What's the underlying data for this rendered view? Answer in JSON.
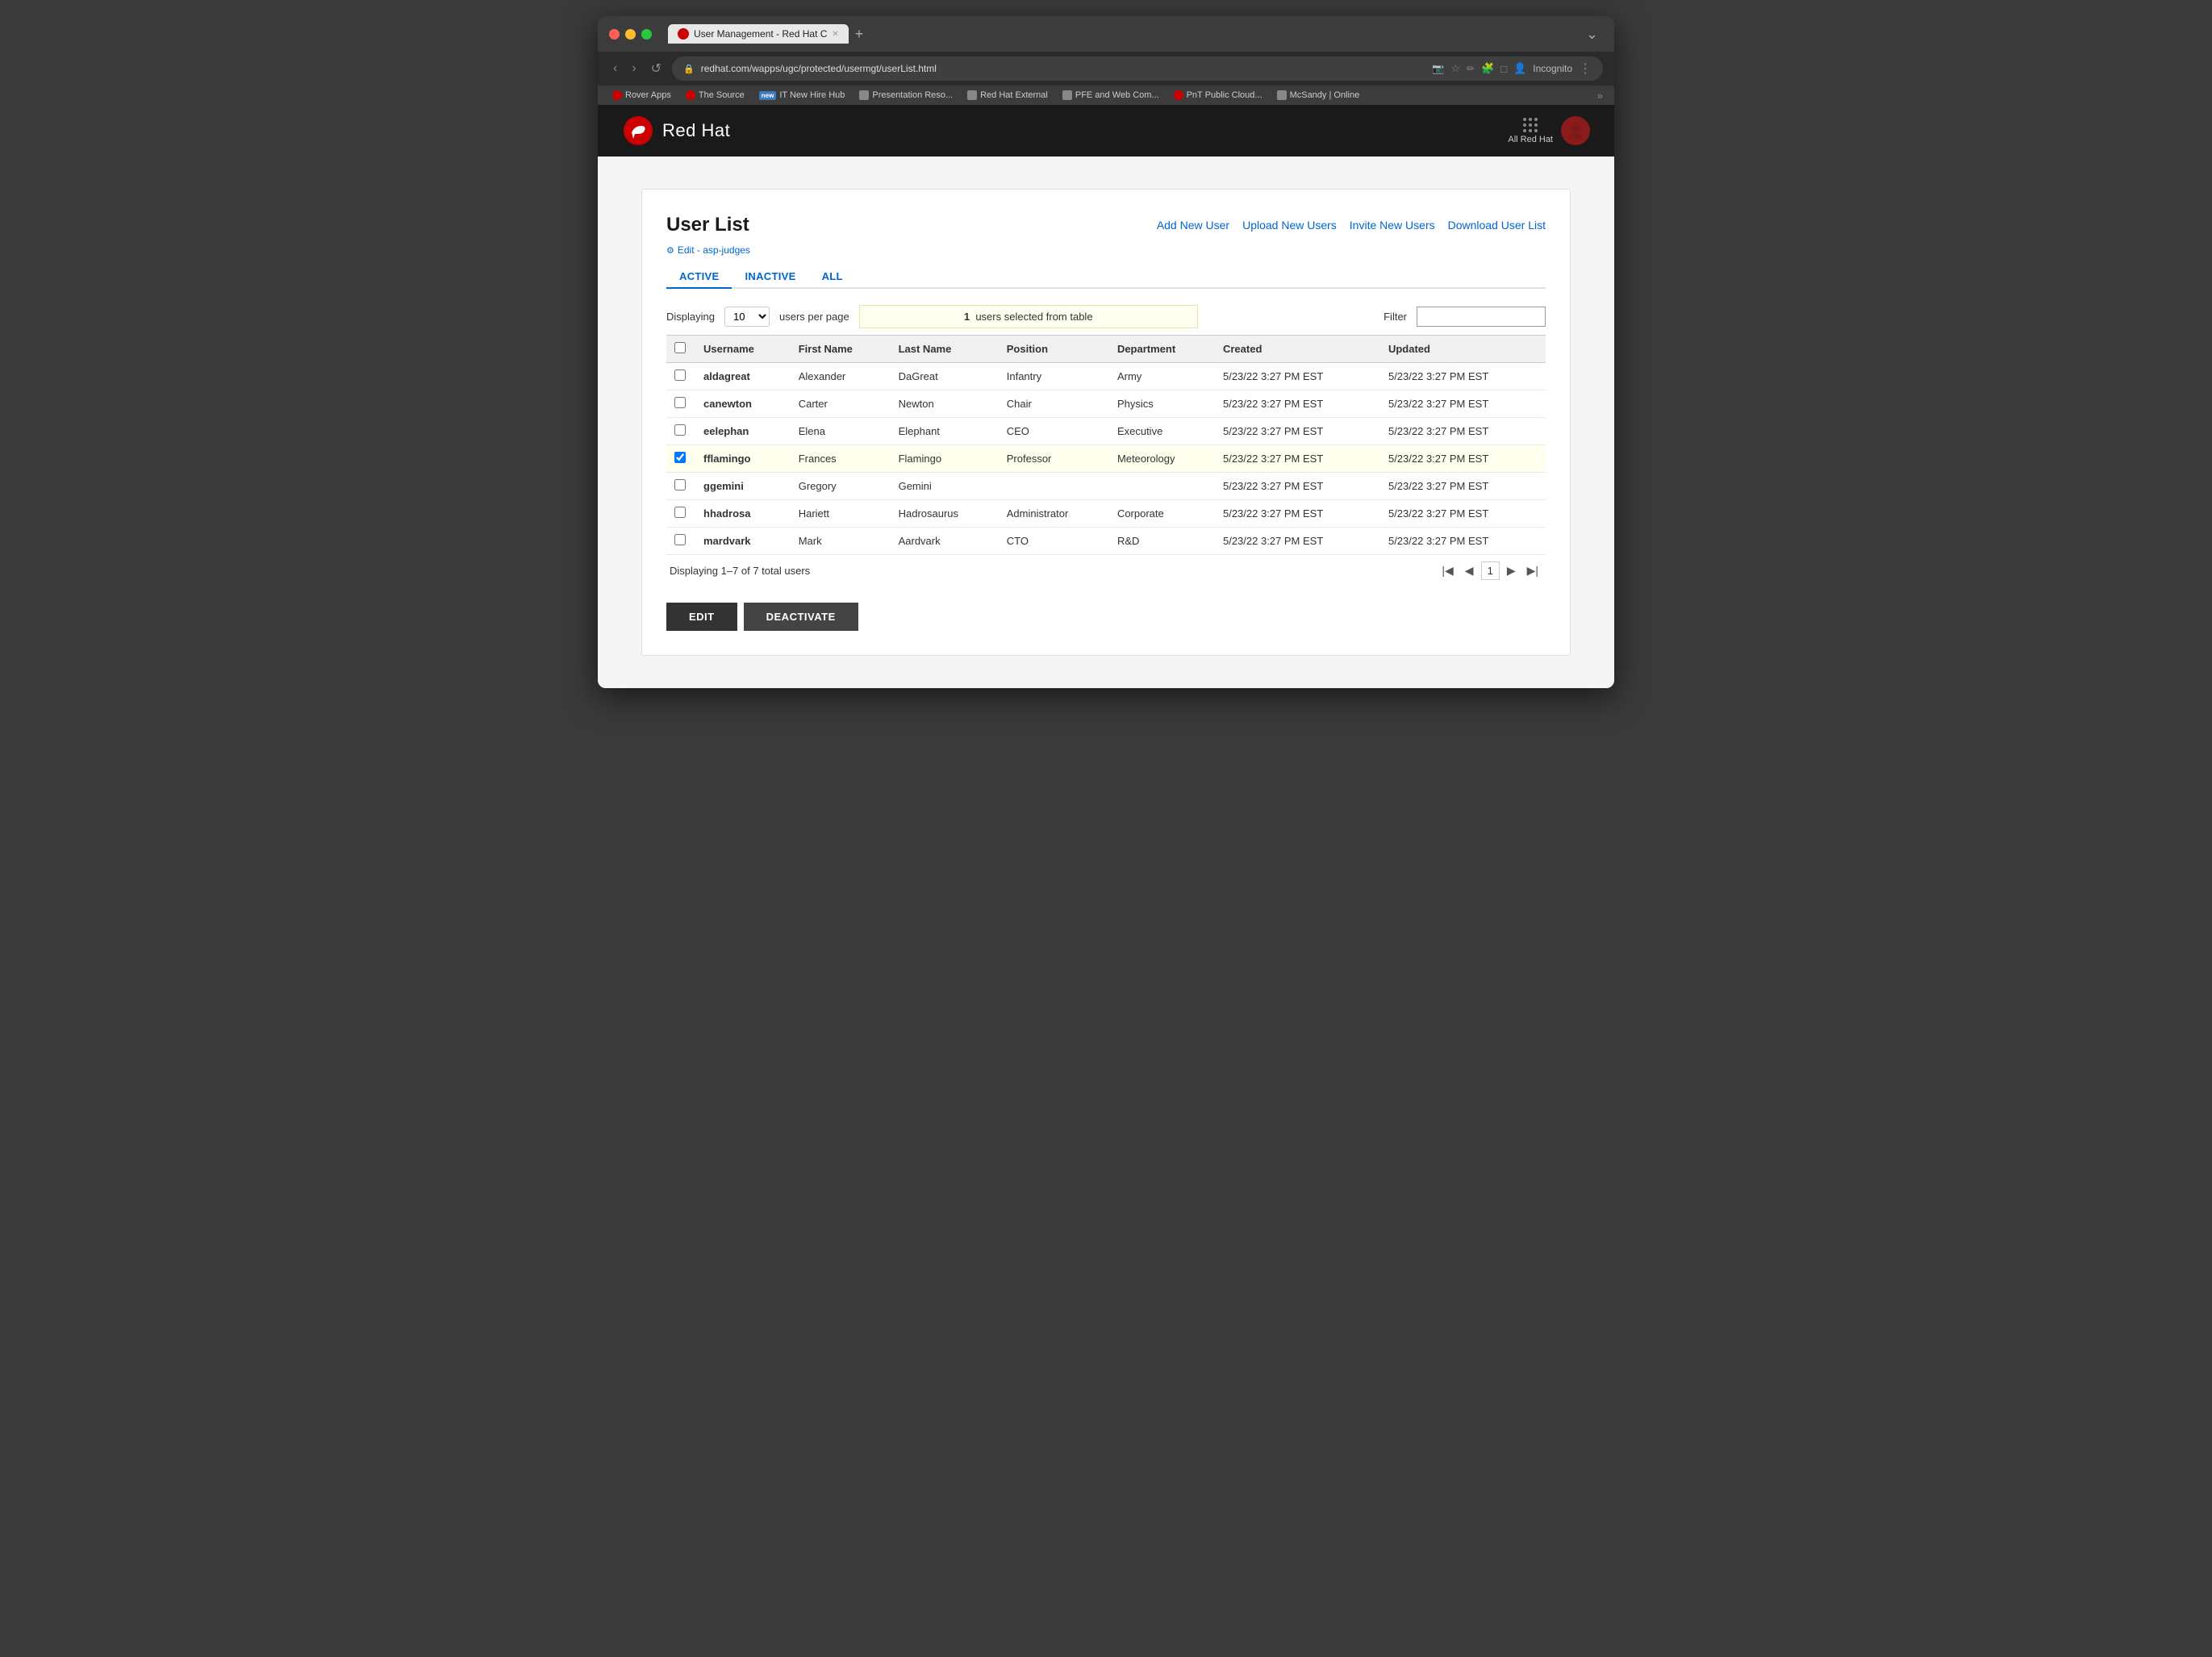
{
  "browser": {
    "tab_title": "User Management - Red Hat C",
    "url": "redhat.com/wapps/ugc/protected/usermgt/userList.html",
    "new_tab_symbol": "+",
    "incognito_label": "Incognito",
    "bookmarks": [
      {
        "label": "Rover Apps",
        "type": "red"
      },
      {
        "label": "The Source",
        "type": "red"
      },
      {
        "label": "IT New Hire Hub",
        "type": "new"
      },
      {
        "label": "Presentation Reso...",
        "type": "folder"
      },
      {
        "label": "Red Hat External",
        "type": "folder"
      },
      {
        "label": "PFE and Web Com...",
        "type": "folder"
      },
      {
        "label": "PnT Public Cloud...",
        "type": "red"
      },
      {
        "label": "McSandy | Online",
        "type": "folder"
      }
    ]
  },
  "header": {
    "logo_text": "Red Hat",
    "all_rh_label": "All Red Hat"
  },
  "page": {
    "title": "User List",
    "edit_link": "Edit - asp-judges",
    "tabs": [
      {
        "label": "ACTIVE",
        "active": true
      },
      {
        "label": "INACTIVE",
        "active": false
      },
      {
        "label": "ALL",
        "active": false
      }
    ],
    "actions": [
      {
        "label": "Add New User"
      },
      {
        "label": "Upload New Users"
      },
      {
        "label": "Invite New Users"
      },
      {
        "label": "Download User List"
      }
    ]
  },
  "table": {
    "displaying_label": "Displaying",
    "per_page_value": "10",
    "users_per_page_label": "users per page",
    "selected_banner": "1  users selected from table",
    "selected_count": "1",
    "filter_label": "Filter",
    "filter_placeholder": "",
    "columns": [
      "Username",
      "First Name",
      "Last Name",
      "Position",
      "Department",
      "Created",
      "Updated"
    ],
    "rows": [
      {
        "selected": false,
        "username": "aldagreat",
        "first_name": "Alexander",
        "last_name": "DaGreat",
        "position": "Infantry",
        "department": "Army",
        "created": "5/23/22 3:27 PM EST",
        "updated": "5/23/22 3:27 PM EST"
      },
      {
        "selected": false,
        "username": "canewton",
        "first_name": "Carter",
        "last_name": "Newton",
        "position": "Chair",
        "department": "Physics",
        "created": "5/23/22 3:27 PM EST",
        "updated": "5/23/22 3:27 PM EST"
      },
      {
        "selected": false,
        "username": "eelephan",
        "first_name": "Elena",
        "last_name": "Elephant",
        "position": "CEO",
        "department": "Executive",
        "created": "5/23/22 3:27 PM EST",
        "updated": "5/23/22 3:27 PM EST"
      },
      {
        "selected": true,
        "username": "fflamingo",
        "first_name": "Frances",
        "last_name": "Flamingo",
        "position": "Professor",
        "department": "Meteorology",
        "created": "5/23/22 3:27 PM EST",
        "updated": "5/23/22 3:27 PM EST"
      },
      {
        "selected": false,
        "username": "ggemini",
        "first_name": "Gregory",
        "last_name": "Gemini",
        "position": "",
        "department": "",
        "created": "5/23/22 3:27 PM EST",
        "updated": "5/23/22 3:27 PM EST"
      },
      {
        "selected": false,
        "username": "hhadrosa",
        "first_name": "Hariett",
        "last_name": "Hadrosaurus",
        "position": "Administrator",
        "department": "Corporate",
        "created": "5/23/22 3:27 PM EST",
        "updated": "5/23/22 3:27 PM EST"
      },
      {
        "selected": false,
        "username": "mardvark",
        "first_name": "Mark",
        "last_name": "Aardvark",
        "position": "CTO",
        "department": "R&D",
        "created": "5/23/22 3:27 PM EST",
        "updated": "5/23/22 3:27 PM EST"
      }
    ],
    "footer_display": "Displaying 1–7 of 7 total users",
    "page_number": "1"
  },
  "bottom_actions": {
    "edit_label": "EDIT",
    "deactivate_label": "DEACTIVATE"
  }
}
